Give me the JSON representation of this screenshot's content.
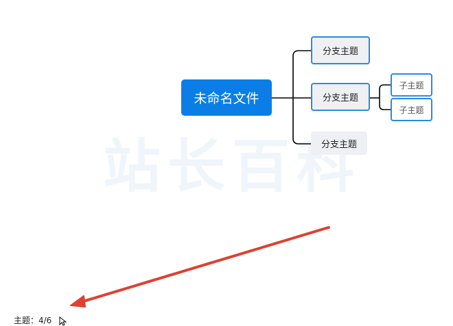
{
  "mindmap": {
    "root_label": "未命名文件",
    "branches": [
      {
        "label": "分支主题"
      },
      {
        "label": "分支主题"
      },
      {
        "label": "分支主题"
      }
    ],
    "subtopics": [
      {
        "label": "子主题"
      },
      {
        "label": "子主题"
      }
    ]
  },
  "status_bar": {
    "topic_count": "主题：4/6"
  },
  "watermark": {
    "text": "站长百科"
  },
  "colors": {
    "accent": "#0a7ee6",
    "node_border": "#2a8ae0",
    "annotation_arrow": "#e04030"
  },
  "icons": {
    "cursor": "mouse-pointer-icon"
  }
}
